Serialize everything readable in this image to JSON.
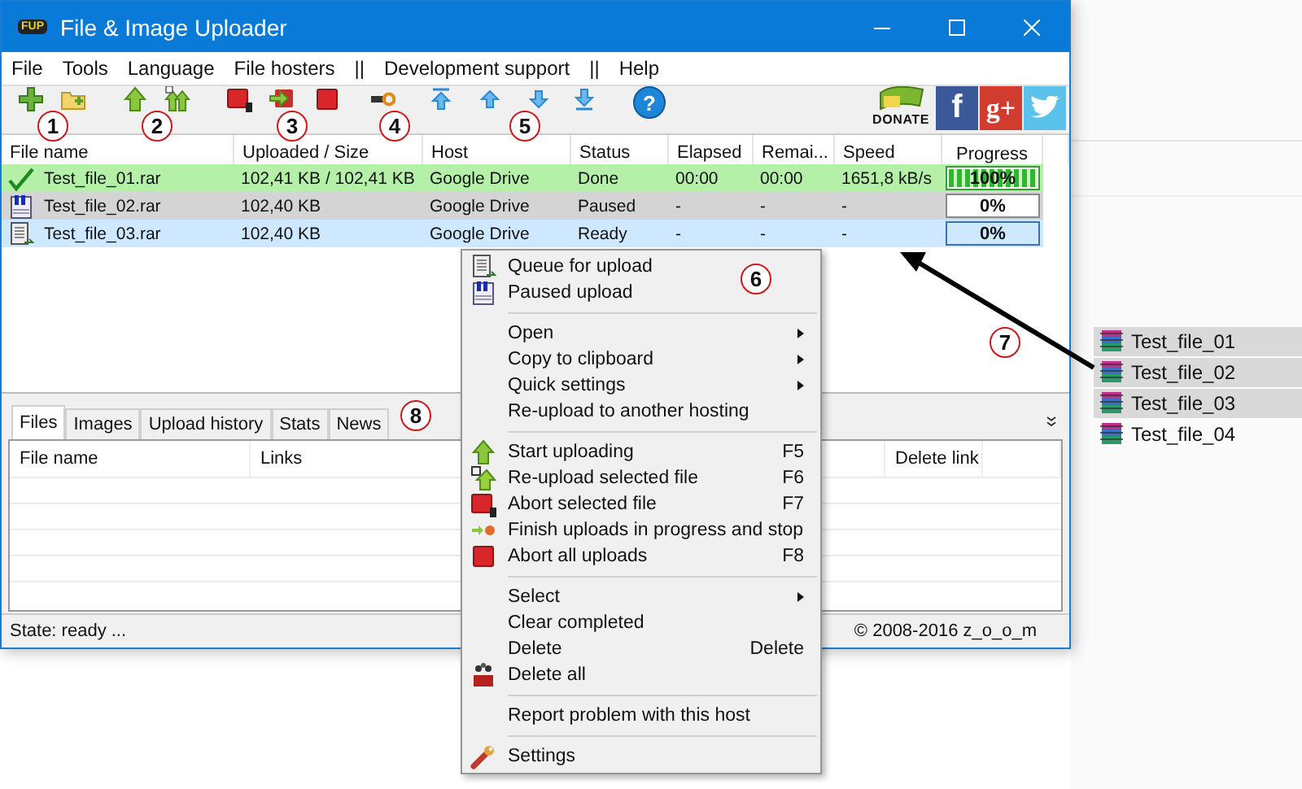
{
  "window": {
    "app_icon_text": "FUP",
    "title": "File & Image Uploader"
  },
  "menu_bar": [
    "File",
    "Tools",
    "Language",
    "File hosters",
    "||",
    "Development support",
    "||",
    "Help"
  ],
  "toolbar": {
    "help_label": "?",
    "donate_label": "DONATE",
    "facebook_label": "f",
    "google_label": "g+"
  },
  "table": {
    "columns": [
      "File name",
      "Uploaded / Size",
      "Host",
      "Status",
      "Elapsed",
      "Remai...",
      "Speed",
      "Progress"
    ],
    "rows": [
      {
        "kind": "done",
        "selected": false,
        "file": "Test_file_01.rar",
        "size": "102,41 KB / 102,41 KB",
        "host": "Google Drive",
        "status": "Done",
        "elapsed": "00:00",
        "remaining": "00:00",
        "speed": "1651,8 kB/s",
        "level": 1,
        "progress": "100%"
      },
      {
        "kind": "paused",
        "selected": false,
        "file": "Test_file_02.rar",
        "size": "102,40 KB",
        "host": "Google Drive",
        "status": "Paused",
        "elapsed": "-",
        "remaining": "-",
        "speed": "-",
        "level": 0,
        "progress": "0%"
      },
      {
        "kind": "ready",
        "selected": true,
        "file": "Test_file_03.rar",
        "size": "102,40 KB",
        "host": "Google Drive",
        "status": "Ready",
        "elapsed": "-",
        "remaining": "-",
        "speed": "-",
        "level": 0,
        "progress": "0%"
      }
    ]
  },
  "tabs": [
    {
      "label": "Files",
      "selected": true
    },
    {
      "label": "Images",
      "selected": false
    },
    {
      "label": "Upload history",
      "selected": false
    },
    {
      "label": "Stats",
      "selected": false
    },
    {
      "label": "News",
      "selected": false
    }
  ],
  "files_table": {
    "columns": [
      "File name",
      "Links",
      "Delete link"
    ]
  },
  "status_bar": {
    "state": "State: ready ...",
    "copyright": "© 2008-2016 z_o_o_m"
  },
  "context_menu": [
    [
      {
        "label": "Queue for upload",
        "submenu": false
      },
      {
        "label": "Paused upload",
        "submenu": false
      }
    ],
    [
      {
        "label": "Open",
        "submenu": true
      },
      {
        "label": "Copy to clipboard",
        "submenu": true
      },
      {
        "label": "Quick settings",
        "submenu": true
      },
      {
        "label": "Re-upload to another hosting",
        "submenu": false
      }
    ],
    [
      {
        "label": "Start uploading",
        "shortcut": "F5",
        "submenu": false
      },
      {
        "label": "Re-upload selected file",
        "shortcut": "F6",
        "submenu": false
      },
      {
        "label": "Abort selected file",
        "shortcut": "F7",
        "submenu": false
      },
      {
        "label": "Finish uploads in progress and stop",
        "submenu": false
      },
      {
        "label": "Abort all uploads",
        "shortcut": "F8",
        "submenu": false
      }
    ],
    [
      {
        "label": "Select",
        "submenu": true
      },
      {
        "label": "Clear completed",
        "submenu": false
      },
      {
        "label": "Delete",
        "shortcut": "Delete",
        "submenu": false
      },
      {
        "label": "Delete all",
        "submenu": false
      }
    ],
    [
      {
        "label": "Report problem with this host",
        "submenu": false
      }
    ],
    [
      {
        "label": "Settings",
        "submenu": false
      }
    ]
  ],
  "explorer_files": [
    {
      "name": "Test_file_01",
      "selected": true
    },
    {
      "name": "Test_file_02",
      "selected": true
    },
    {
      "name": "Test_file_03",
      "selected": true
    },
    {
      "name": "Test_file_04",
      "selected": false
    }
  ],
  "callouts": [
    "1",
    "2",
    "3",
    "4",
    "5",
    "6",
    "7",
    "8"
  ]
}
